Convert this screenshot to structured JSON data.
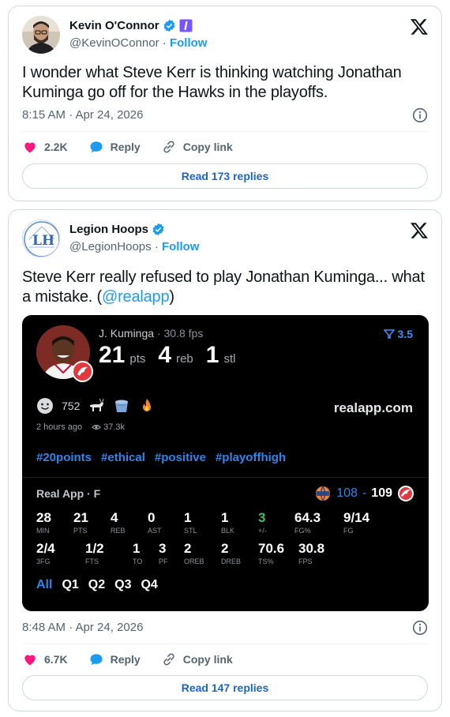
{
  "tweets": [
    {
      "author": {
        "name": "Kevin O'Connor",
        "handle": "@KevinOConnor",
        "follow": "Follow"
      },
      "text": "I wonder what Steve Kerr is thinking watching Jonathan Kuminga go off for the Hawks in the playoffs.",
      "time": "8:15 AM · Apr 24, 2026",
      "likes": "2.2K",
      "reply_label": "Reply",
      "copy_label": "Copy link",
      "read_replies": "Read 173 replies"
    },
    {
      "author": {
        "name": "Legion Hoops",
        "handle": "@LegionHoops",
        "follow": "Follow"
      },
      "text_before": "Steve Kerr really refused to play Jonathan Kuminga... what a mistake. (",
      "mention": "@realapp",
      "text_after": ")",
      "time": "8:48 AM · Apr 24, 2026",
      "likes": "6.7K",
      "reply_label": "Reply",
      "copy_label": "Copy link",
      "read_replies": "Read 147 replies"
    }
  ],
  "separator": "·",
  "app_card": {
    "player": "J. Kuminga",
    "fps": "30.8 fps",
    "pts": "21",
    "pts_label": "pts",
    "reb": "4",
    "reb_label": "reb",
    "stl": "1",
    "stl_label": "stl",
    "odds": "3.5",
    "reactions_count": "752",
    "brand": "realapp.com",
    "posted": "2 hours ago",
    "views": "37.3k",
    "tags": [
      "#20points",
      "#ethical",
      "#positive",
      "#playoffhigh"
    ],
    "team_line": "Real App · F",
    "score_home": "108",
    "score_dash": "-",
    "score_away": "109",
    "stats_row1": [
      {
        "v": "28",
        "l": "MIN"
      },
      {
        "v": "21",
        "l": "PTS"
      },
      {
        "v": "4",
        "l": "REB"
      },
      {
        "v": "0",
        "l": "AST"
      },
      {
        "v": "1",
        "l": "STL"
      },
      {
        "v": "1",
        "l": "BLK"
      },
      {
        "v": "3",
        "l": "+/-"
      },
      {
        "v": "64.3",
        "l": "FG%"
      },
      {
        "v": "9/14",
        "l": "FG"
      }
    ],
    "stats_row2": [
      {
        "v": "2/4",
        "l": "3FG"
      },
      {
        "v": "1/2",
        "l": "FTS"
      },
      {
        "v": "1",
        "l": "TO"
      },
      {
        "v": "3",
        "l": "PF"
      },
      {
        "v": "2",
        "l": "OREB"
      },
      {
        "v": "2",
        "l": "DREB"
      },
      {
        "v": "70.6",
        "l": "TS%"
      },
      {
        "v": "30.8",
        "l": "FPS"
      }
    ],
    "periods": [
      "All",
      "Q1",
      "Q2",
      "Q3",
      "Q4"
    ]
  },
  "colors": {
    "accent": "#1d9bf0",
    "like": "#f91880",
    "app_blue": "#2f86ea",
    "plus_minus": "#3fbf5a"
  }
}
